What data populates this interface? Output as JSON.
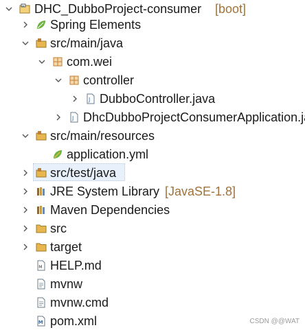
{
  "project": {
    "name": "DHC_DubboProject-consumer",
    "decoration": "[boot]"
  },
  "items": [
    {
      "label": "Spring Elements"
    },
    {
      "label": "src/main/java"
    },
    {
      "label": "com.wei"
    },
    {
      "label": "controller"
    },
    {
      "label": "DubboController.java"
    },
    {
      "label": "DhcDubboProjectConsumerApplication.java"
    },
    {
      "label": "src/main/resources"
    },
    {
      "label": "application.yml"
    },
    {
      "label": "src/test/java"
    },
    {
      "label": "JRE System Library",
      "decoration": "[JavaSE-1.8]"
    },
    {
      "label": "Maven Dependencies"
    },
    {
      "label": "src"
    },
    {
      "label": "target"
    },
    {
      "label": "HELP.md"
    },
    {
      "label": "mvnw"
    },
    {
      "label": "mvnw.cmd"
    },
    {
      "label": "pom.xml"
    }
  ],
  "watermark": "CSDN @@WAT",
  "colors": {
    "decoration": "#a0723a",
    "selection": "#e8f0fb",
    "folder": "#e8b64f",
    "package": "#c07d36",
    "spring": "#6db33f"
  },
  "icons": [
    "project-icon",
    "spring-leaf-icon",
    "source-folder-icon",
    "package-icon",
    "java-file-icon",
    "yml-file-icon",
    "library-icon",
    "folder-icon",
    "text-file-icon",
    "xml-file-icon"
  ]
}
